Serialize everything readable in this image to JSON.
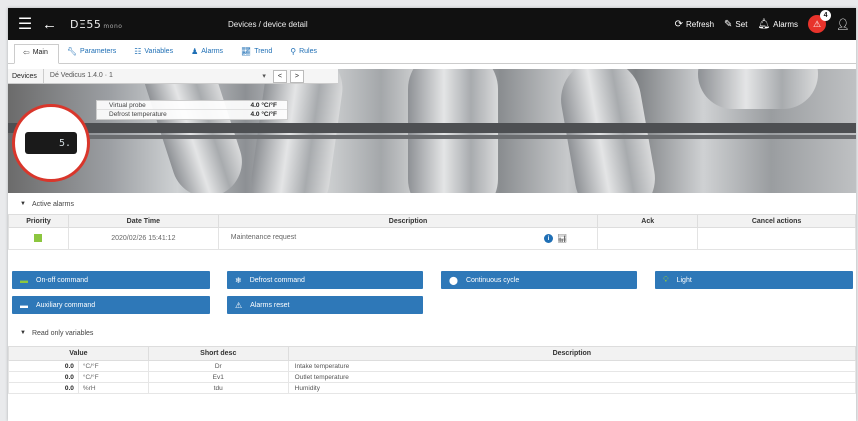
{
  "topbar": {
    "logo": "DΞ55",
    "logo_suffix": "mono",
    "title": "Devices / device detail",
    "refresh": "Refresh",
    "set": "Set",
    "alarms": "Alarms",
    "alarm_count": "4"
  },
  "tabs": [
    {
      "label": "Main",
      "icon": "arrow-icon"
    },
    {
      "label": "Parameters",
      "icon": "wrench-icon"
    },
    {
      "label": "Variables",
      "icon": "list-icon"
    },
    {
      "label": "Alarms",
      "icon": "bell-icon"
    },
    {
      "label": "Trend",
      "icon": "chart-icon"
    },
    {
      "label": "Rules",
      "icon": "filter-icon"
    }
  ],
  "device": {
    "label": "Devices",
    "selected": "Dé Vedicus 1.4.0 · 1",
    "prev": "<",
    "next": ">",
    "display": "5.",
    "probe_rows": [
      {
        "key": "Virtual probe",
        "value": "4.0 °C/°F"
      },
      {
        "key": "Defrost temperature",
        "value": "4.0 °C/°F"
      }
    ]
  },
  "active_alarms": {
    "title": "Active alarms",
    "headers": [
      "Priority",
      "Date Time",
      "Description",
      "Ack",
      "Cancel actions"
    ],
    "rows": [
      {
        "date": "2020/02/26 15:41:12",
        "description": "Maintenance request",
        "priority_color": "#8cc63f"
      }
    ]
  },
  "commands": [
    {
      "label": "On-off command",
      "icon": "power-icon"
    },
    {
      "label": "Defrost command",
      "icon": "snowflake-icon"
    },
    {
      "label": "Continuous cycle",
      "icon": "cycle-icon"
    },
    {
      "label": "Light",
      "icon": "bulb-icon"
    },
    {
      "label": "Auxiliary command",
      "icon": "aux-icon"
    },
    {
      "label": "Alarms reset",
      "icon": "reset-icon"
    }
  ],
  "readonly": {
    "title": "Read only variables",
    "headers": [
      "Value",
      "Short desc",
      "Description"
    ],
    "rows": [
      {
        "value": "0.0",
        "unit": "°C/°F",
        "short": "Dr",
        "desc": "Intake temperature"
      },
      {
        "value": "0.0",
        "unit": "°C/°F",
        "short": "Ev1",
        "desc": "Outlet temperature"
      },
      {
        "value": "0.0",
        "unit": "%rH",
        "short": "tdu",
        "desc": "Humidity"
      }
    ]
  },
  "colors": {
    "accent": "#2e78b8",
    "topbar": "#111111",
    "alarm_badge": "#e8332b",
    "link": "#1f6fb5"
  }
}
